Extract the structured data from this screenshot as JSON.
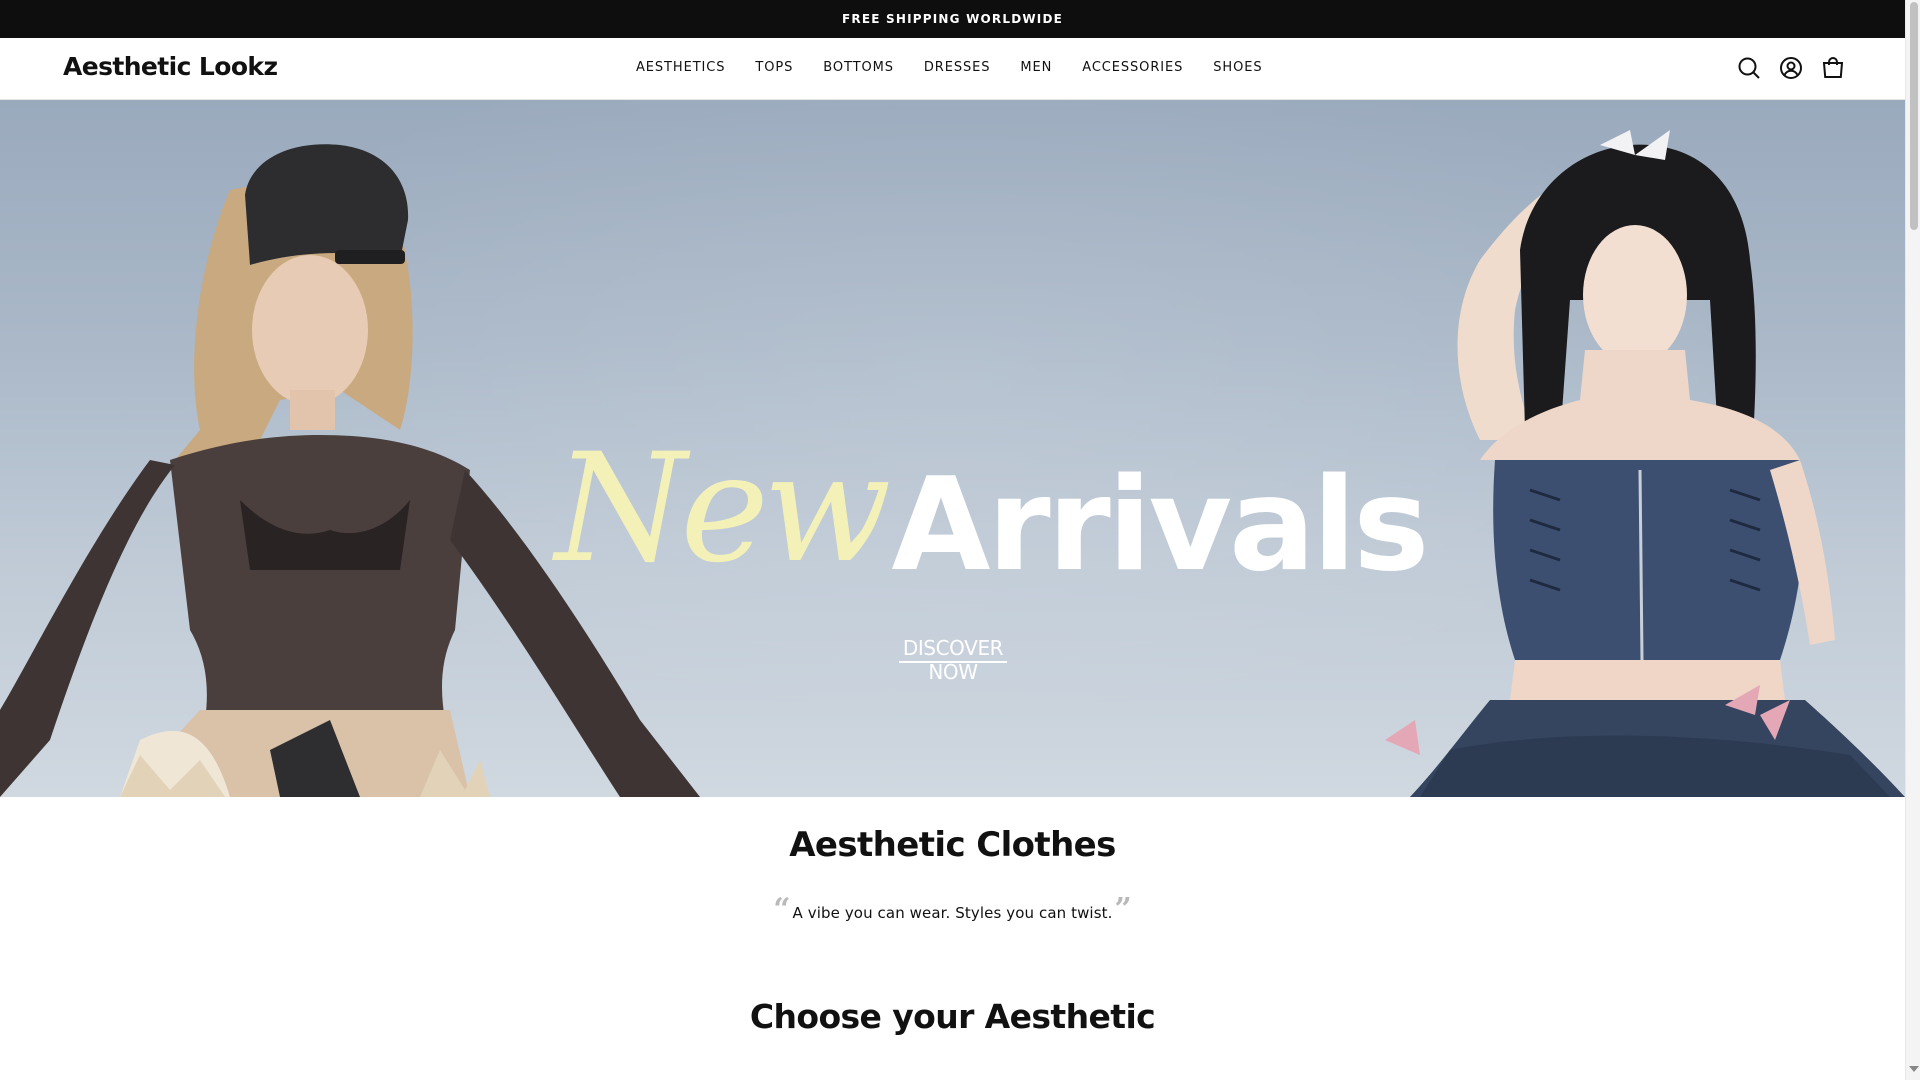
{
  "announcement": {
    "text": "FREE SHIPPING WORLDWIDE"
  },
  "header": {
    "logo": "Aesthetic Lookz",
    "nav": [
      {
        "label": "AESTHETICS"
      },
      {
        "label": "TOPS"
      },
      {
        "label": "BOTTOMS"
      },
      {
        "label": "DRESSES"
      },
      {
        "label": "MEN"
      },
      {
        "label": "ACCESSORIES"
      },
      {
        "label": "SHOES"
      }
    ],
    "icons": [
      "search-icon",
      "account-icon",
      "cart-icon"
    ]
  },
  "hero": {
    "title_script": "New",
    "title_main": "Arrivals",
    "cta": "DISCOVER NOW",
    "colors": {
      "script": "#f3f1b8",
      "main": "#ffffff",
      "background": "#a9b7c7"
    }
  },
  "content": {
    "heading": "Aesthetic Clothes",
    "quote": "A vibe you can wear. Styles you can twist.",
    "quote_open": "“",
    "quote_close": "”",
    "section_heading": "Choose your Aesthetic"
  }
}
